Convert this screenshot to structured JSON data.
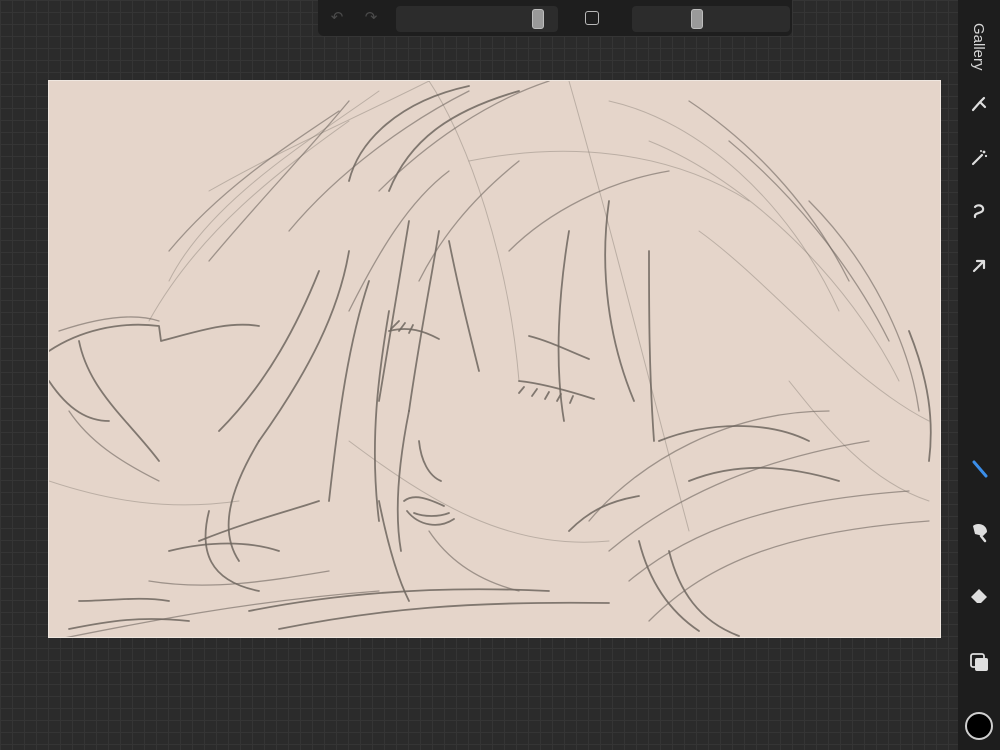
{
  "app": {
    "gallery_label": "Gallery"
  },
  "top_bar": {
    "brush_size": 0.92,
    "opacity": 0.4
  },
  "sidebar": {
    "tools": [
      "actions-icon",
      "adjustments-icon",
      "selection-icon",
      "transform-icon",
      "brush-icon",
      "smudge-icon",
      "eraser-icon",
      "layers-icon"
    ],
    "active_tool": "brush-icon",
    "active_color": "#000000"
  },
  "colors": {
    "canvas_paper": "#e5d5ca",
    "sketch_stroke": "#6e665f",
    "accent_blue": "#3b8ee9"
  }
}
